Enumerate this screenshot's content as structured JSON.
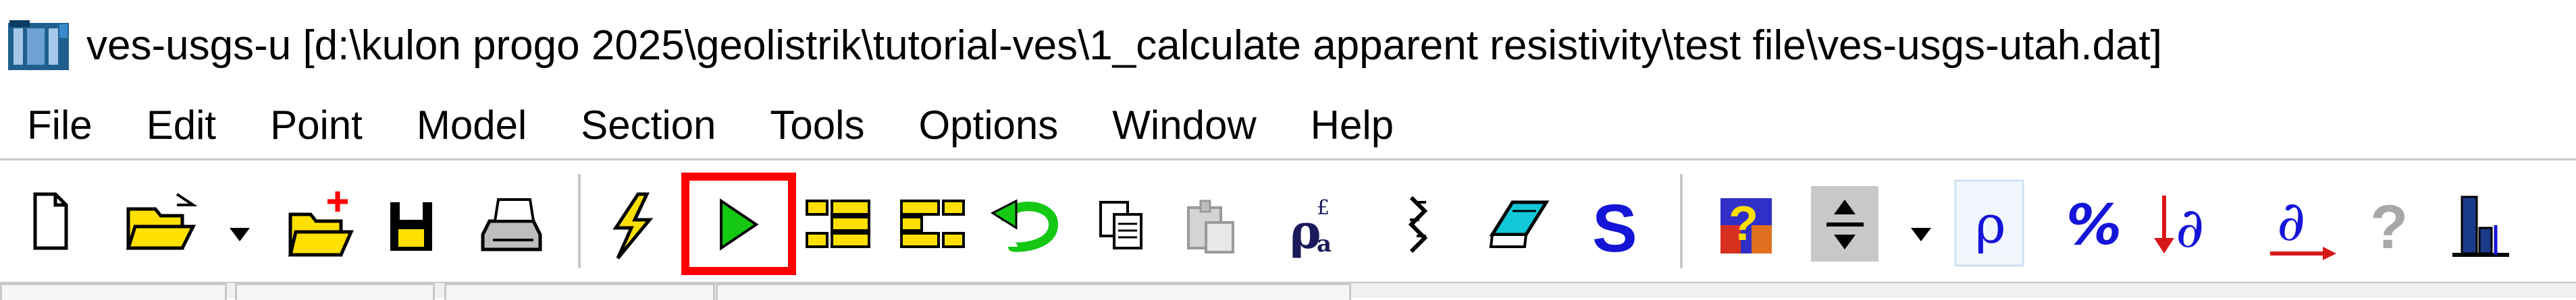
{
  "window": {
    "title": "ves-usgs-u [d:\\kulon progo 2025\\geolistrik\\tutorial-ves\\1_calculate apparent resistivity\\test file\\ves-usgs-utah.dat]",
    "app_icon": "ipi-app-icon"
  },
  "menubar": {
    "items": [
      "File",
      "Edit",
      "Point",
      "Model",
      "Section",
      "Tools",
      "Options",
      "Window",
      "Help"
    ]
  },
  "toolbar": {
    "buttons": [
      {
        "name": "new-file-button",
        "icon": "new-document-icon"
      },
      {
        "name": "open-file-button",
        "icon": "open-folder-icon"
      },
      {
        "name": "open-dropdown-button",
        "icon": "dropdown-arrow-icon"
      },
      {
        "name": "add-file-button",
        "icon": "folder-plus-icon"
      },
      {
        "name": "save-button",
        "icon": "floppy-disk-icon"
      },
      {
        "name": "print-button",
        "icon": "printer-icon"
      },
      {
        "name": "calculate-button",
        "icon": "lightning-icon"
      },
      {
        "name": "run-button",
        "icon": "green-play-icon",
        "highlighted": true,
        "highlight_color": "#ff0000"
      },
      {
        "name": "layer-button-1",
        "icon": "yellow-boxes-left-icon"
      },
      {
        "name": "layer-button-2",
        "icon": "yellow-boxes-right-icon"
      },
      {
        "name": "undo-button",
        "icon": "green-undo-arrow-icon"
      },
      {
        "name": "copy-button",
        "icon": "copy-icon"
      },
      {
        "name": "paste-button",
        "icon": "paste-icon",
        "disabled": true
      },
      {
        "name": "rho-apparent-button",
        "icon": "rho-a-icon"
      },
      {
        "name": "equivalence-button",
        "icon": "equivalence-icon"
      },
      {
        "name": "notes-button",
        "icon": "cyan-notebook-icon"
      },
      {
        "name": "s-button",
        "icon": "blue-s-icon"
      },
      {
        "name": "help-palette-button",
        "icon": "colored-help-icon"
      },
      {
        "name": "split-button",
        "icon": "split-arrows-icon"
      },
      {
        "name": "split-dropdown-button",
        "icon": "dropdown-arrow-icon"
      },
      {
        "name": "rho-button",
        "icon": "rho-icon",
        "active": true
      },
      {
        "name": "percent-button",
        "icon": "percent-icon"
      },
      {
        "name": "derivative-down-button",
        "icon": "red-down-derivative-icon"
      },
      {
        "name": "derivative-right-button",
        "icon": "red-right-derivative-icon"
      },
      {
        "name": "help-button",
        "icon": "gray-question-icon",
        "disabled": true
      },
      {
        "name": "profile-button",
        "icon": "profile-bars-icon"
      }
    ],
    "colors": {
      "accent_blue": "#1515d8",
      "icon_yellow": "#ffe000",
      "icon_green": "#14c814",
      "highlight_red": "#ff0000",
      "cyan": "#12c8d8"
    }
  }
}
